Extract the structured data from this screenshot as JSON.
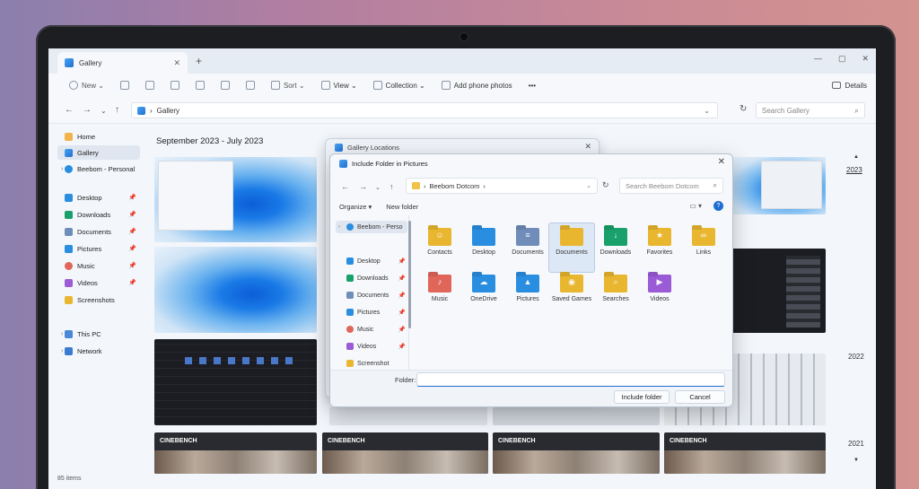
{
  "window": {
    "tab_label": "Gallery",
    "tab_close": "✕",
    "new_tab": "+",
    "controls": [
      "—",
      "▢",
      "✕"
    ]
  },
  "toolbar": {
    "new_label": "New ⌄",
    "sort_label": "Sort ⌄",
    "view_label": "View ⌄",
    "collection_label": "Collection ⌄",
    "add_phone_label": "Add phone photos",
    "more_label": "•••",
    "details_label": "Details"
  },
  "address": {
    "crumb": "Gallery",
    "search_placeholder": "Search Gallery"
  },
  "sidebar": {
    "items": [
      {
        "label": "Home"
      },
      {
        "label": "Gallery"
      },
      {
        "label": "Beebom - Personal"
      },
      {
        "label": "Desktop"
      },
      {
        "label": "Downloads"
      },
      {
        "label": "Documents"
      },
      {
        "label": "Pictures"
      },
      {
        "label": "Music"
      },
      {
        "label": "Videos"
      },
      {
        "label": "Screenshots"
      },
      {
        "label": "This PC"
      },
      {
        "label": "Network"
      }
    ]
  },
  "gallery": {
    "date_range": "September 2023 - July 2023",
    "years": [
      "2023",
      "2022",
      "2021"
    ],
    "thumb_label": "CINEBENCH",
    "item_count": "85 items"
  },
  "back_dialog": {
    "title": "Gallery Locations"
  },
  "dialog": {
    "title": "Include Folder in Pictures",
    "path": "Beebom Dotcom",
    "search_placeholder": "Search Beebom Dotcom",
    "organize_label": "Organize ▾",
    "new_folder_label": "New folder",
    "sidebar": [
      {
        "label": "Beebom - Perso"
      },
      {
        "label": "Desktop"
      },
      {
        "label": "Downloads"
      },
      {
        "label": "Documents"
      },
      {
        "label": "Pictures"
      },
      {
        "label": "Music"
      },
      {
        "label": "Videos"
      },
      {
        "label": "Screenshot"
      }
    ],
    "folders": [
      {
        "label": "Contacts",
        "color": "#e9b62f",
        "glyph": "☺"
      },
      {
        "label": "Desktop",
        "color": "#2a8ee0",
        "glyph": ""
      },
      {
        "label": "Documents",
        "color": "#6f8db8",
        "glyph": "≡"
      },
      {
        "label": "Documents",
        "color": "#e9b62f",
        "glyph": ""
      },
      {
        "label": "Downloads",
        "color": "#1aa06b",
        "glyph": "↓"
      },
      {
        "label": "Favorites",
        "color": "#e9b62f",
        "glyph": "★"
      },
      {
        "label": "Links",
        "color": "#e9b62f",
        "glyph": "∞"
      },
      {
        "label": "Music",
        "color": "#e0665a",
        "glyph": "♪"
      },
      {
        "label": "OneDrive",
        "color": "#2a8ee0",
        "glyph": "☁"
      },
      {
        "label": "Pictures",
        "color": "#2a8ee0",
        "glyph": "▲"
      },
      {
        "label": "Saved Games",
        "color": "#e9b62f",
        "glyph": "◉"
      },
      {
        "label": "Searches",
        "color": "#e9b62f",
        "glyph": "⌕"
      },
      {
        "label": "Videos",
        "color": "#9b5bd6",
        "glyph": "▶"
      }
    ],
    "folder_label": "Folder:",
    "folder_value": "",
    "include_button": "Include folder",
    "cancel_button": "Cancel"
  },
  "colors": {
    "accent": "#1f6fd1",
    "folder_yellow": "#e9b62f"
  }
}
